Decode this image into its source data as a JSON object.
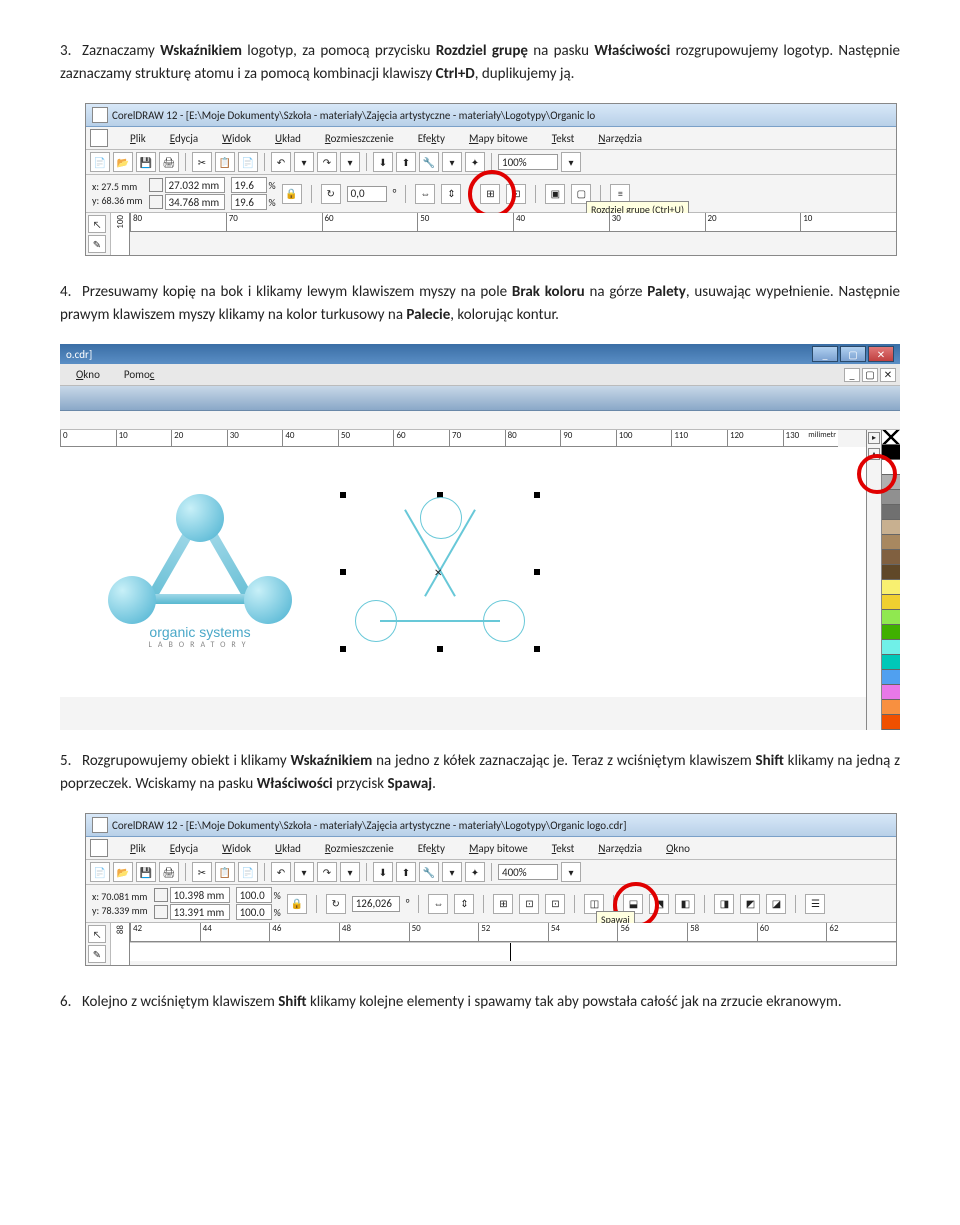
{
  "items": {
    "p3": {
      "num": "3.",
      "t1": "Zaznaczamy ",
      "t2": " logotyp, za pomocą przycisku ",
      "t3": " na pasku ",
      "t4": " rozgrupowujemy logotyp. Następnie zaznaczamy strukturę atomu i za pomocą kombinacji klawiszy ",
      "t5": ", duplikujemy ją.",
      "b1": "Wskaźnikiem",
      "b2": "Rozdziel grupę",
      "b3": "Właściwości",
      "b4": "Ctrl+D"
    },
    "p4": {
      "num": "4.",
      "t1": "Przesuwamy kopię na bok i klikamy lewym klawiszem myszy na pole ",
      "t2": " na górze ",
      "t3": ", usuwając wypełnienie. Następnie prawym klawiszem myszy klikamy na kolor turkusowy na ",
      "t4": ", kolorując kontur.",
      "b1": "Brak koloru",
      "b2": "Palety",
      "b3": "Palecie"
    },
    "p5": {
      "num": "5.",
      "t1": "Rozgrupowujemy obiekt i klikamy ",
      "t2": " na jedno z kółek zaznaczając je. Teraz z wciśniętym klawiszem ",
      "t3": " klikamy na jedną z poprzeczek. Wciskamy na pasku ",
      "t4": " przycisk ",
      "t5": ".",
      "b1": "Wskaźnikiem",
      "b2": "Shift",
      "b3": "Właściwości",
      "b4": "Spawaj"
    },
    "p6": {
      "num": "6.",
      "t1": "Kolejno z wciśniętym klawiszem ",
      "t2": " klikamy kolejne elementy i spawamy tak aby powstała całość jak na zrzucie ekranowym.",
      "b1": "Shift"
    }
  },
  "shot1": {
    "title": "CorelDRAW 12 - [E:\\Moje Dokumenty\\Szkoła - materiały\\Zajęcia artystyczne - materiały\\Logotypy\\Organic lo",
    "menu": [
      "Plik",
      "Edycja",
      "Widok",
      "Układ",
      "Rozmieszczenie",
      "Efekty",
      "Mapy bitowe",
      "Tekst",
      "Narzędzia"
    ],
    "zoom": "100%",
    "x": "x: 27.5 mm",
    "y": "y: 68.36 mm",
    "w": "27.032 mm",
    "h": "34.768 mm",
    "sx": "19.6",
    "sy": "19.6",
    "rot": "0,0",
    "tooltip": "Rozdziel grupę (Ctrl+U)",
    "ruler": [
      "80",
      "70",
      "60",
      "50",
      "40",
      "30",
      "20",
      "10"
    ],
    "rv": "100"
  },
  "shot2": {
    "titleend": "o.cdr]",
    "menu": [
      "Okno",
      "Pomoc"
    ],
    "ruler": [
      "0",
      "10",
      "20",
      "30",
      "40",
      "50",
      "60",
      "70",
      "80",
      "90",
      "100",
      "110",
      "120",
      "130"
    ],
    "unit": "milimetr",
    "logo1": "organic systems",
    "logo2": "LABORATORY",
    "palette": [
      "#000000",
      "#ffffff",
      "#a0a0a0",
      "#808080",
      "#606060",
      "#c0a080",
      "#a08060",
      "#806040",
      "#604830",
      "#ffff80",
      "#ffe040",
      "#80ff40",
      "#40c000",
      "#208000",
      "#80ffff",
      "#00d0c0",
      "#40a0ff",
      "#2060c0",
      "#ff80ff",
      "#c040a0",
      "#ff8040",
      "#ff4000"
    ]
  },
  "shot3": {
    "title": "CorelDRAW 12 - [E:\\Moje Dokumenty\\Szkoła - materiały\\Zajęcia artystyczne - materiały\\Logotypy\\Organic logo.cdr]",
    "menu": [
      "Plik",
      "Edycja",
      "Widok",
      "Układ",
      "Rozmieszczenie",
      "Efekty",
      "Mapy bitowe",
      "Tekst",
      "Narzędzia",
      "Okno"
    ],
    "zoom": "400%",
    "x": "x: 70.081 mm",
    "y": "y: 78.339 mm",
    "w": "10.398 mm",
    "h": "13.391 mm",
    "sx": "100.0",
    "sy": "100.0",
    "rot": "126,026",
    "tooltip": "Spawaj",
    "ruler": [
      "42",
      "44",
      "46",
      "48",
      "50",
      "52",
      "54",
      "56",
      "58",
      "60",
      "62"
    ],
    "rv": "88"
  }
}
